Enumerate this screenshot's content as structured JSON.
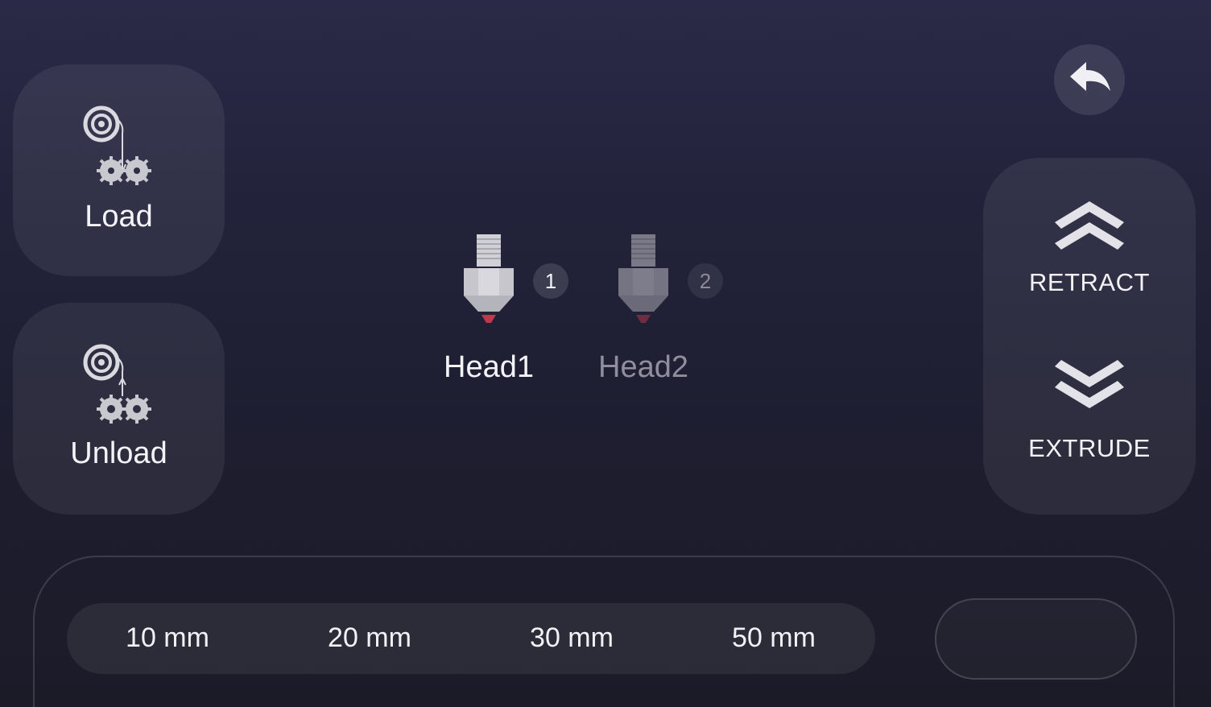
{
  "filament": {
    "load_label": "Load",
    "unload_label": "Unload",
    "load_icon": "filament-spool-load-icon",
    "unload_icon": "filament-spool-unload-icon"
  },
  "back": {
    "icon": "back-arrow-icon"
  },
  "heads": [
    {
      "name": "Head1",
      "number": "1",
      "selected": true
    },
    {
      "name": "Head2",
      "number": "2",
      "selected": false
    }
  ],
  "move": {
    "retract_label": "RETRACT",
    "extrude_label": "EXTRUDE",
    "retract_icon": "double-chevron-up-icon",
    "extrude_icon": "double-chevron-down-icon"
  },
  "distance": {
    "options": [
      "10 mm",
      "20 mm",
      "30 mm",
      "50 mm"
    ],
    "custom_value": ""
  },
  "colors": {
    "background": "#22223a",
    "panel": "#343448",
    "text": "#f2f2f6",
    "muted_text": "#8e8e9c",
    "nozzle_tip": "#c0394a"
  }
}
